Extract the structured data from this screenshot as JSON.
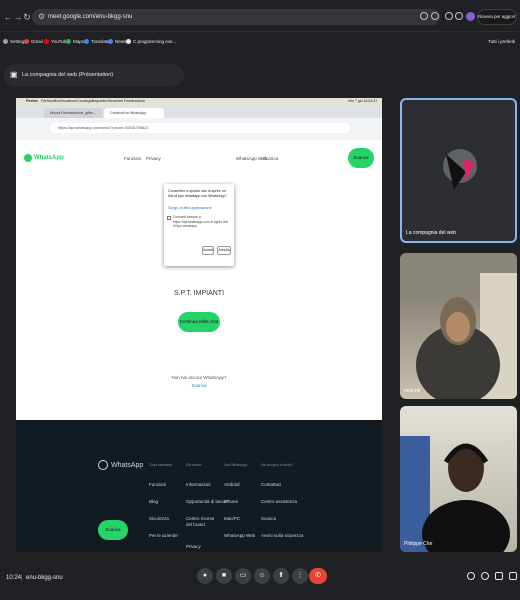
{
  "browser": {
    "url": "meet.google.com/enu-bkgg-snu",
    "update_label": "Riavvia per aggiornare",
    "bookmarks": [
      "Settings",
      "Gmail",
      "YouTube",
      "Maps",
      "Translate",
      "News",
      "C programming exe..."
    ],
    "bookmarks_right": "Tutti i preferiti"
  },
  "meet": {
    "presentation_title": "La compagnia del web (Présentation)",
    "clock": "10:24",
    "meeting_code": "enu-bkgg-snu",
    "participants": [
      {
        "name": "La compagnia del web"
      },
      {
        "name": "nesrine"
      },
      {
        "name": "Philippe Che"
      }
    ]
  },
  "shared": {
    "mac_menu": [
      "Firefox",
      "File",
      "Modifica",
      "Visualizza",
      "Cronologia",
      "Segnalibri",
      "Strumenti",
      "Finestra",
      "Aiuto"
    ],
    "mac_clock": "Ven 7 giu 16:24:37",
    "tabs": [
      "Nuova Formattazione_gfibe...",
      "Condividi su WhatsApp"
    ],
    "inner_url": "https://api.whatsapp.com/send/?phone=39331798823",
    "whatsapp": {
      "brand": "WhatsApp",
      "nav": [
        "Funzioni",
        "Privacy",
        "WhatsApp Web",
        "Scarica"
      ],
      "download_label": "Scarica",
      "company": "S.P.T. IMPIANTI",
      "chat_button": "Continua nella chat",
      "no_app": "Non hai ancora WhatsApp?",
      "download_link": "Scarica"
    },
    "dialog": {
      "question": "Consentire a questo sito di aprire un link di tipo whatsapp con WhatsApp?",
      "choose": "Scegli un'altra applicazione",
      "remember": "Consenti sempre a https://api.whatsapp.com di aprire link di tipo whatsapp",
      "open": "Accedi",
      "cancel": "Annulla"
    },
    "footer": {
      "columns": [
        {
          "head": "Cosa facciamo",
          "items": [
            "Funzioni",
            "Blog",
            "Sicurezza",
            "Per le aziende"
          ]
        },
        {
          "head": "Chi siamo",
          "items": [
            "Informazioni",
            "Opportunità di lavoro",
            "Centro risorse del brand",
            "Privacy"
          ]
        },
        {
          "head": "Usa WhatsApp",
          "items": [
            "Android",
            "iPhone",
            "Mac/PC",
            "WhatsApp Web"
          ]
        },
        {
          "head": "Ha bisogno di aiuto?",
          "items": [
            "Contattaci",
            "Centro assistenza",
            "Scarica",
            "Avvisi sulla sicurezza"
          ]
        }
      ]
    }
  }
}
